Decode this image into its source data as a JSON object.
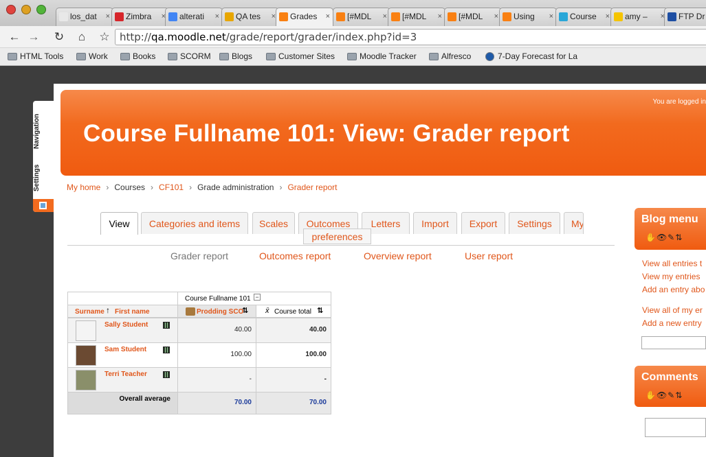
{
  "browser": {
    "tabs": [
      {
        "label": "los_dat",
        "color": "#e8e8e8"
      },
      {
        "label": "Zimbra",
        "color": "#d6262b"
      },
      {
        "label": "alterati",
        "color": "#4285f4"
      },
      {
        "label": "QA tes",
        "color": "#e8a600"
      },
      {
        "label": "Grades",
        "color": "#f98012"
      },
      {
        "label": "[#MDL",
        "color": "#f98012"
      },
      {
        "label": "[#MDL",
        "color": "#f98012"
      },
      {
        "label": "[#MDL",
        "color": "#f98012"
      },
      {
        "label": "Using",
        "color": "#f98012"
      },
      {
        "label": "Course",
        "color": "#2aa7d8"
      },
      {
        "label": "amy –",
        "color": "#f5c400"
      },
      {
        "label": "FTP Dr",
        "color": "#1e4fa3"
      }
    ],
    "address": {
      "prefix": "http://",
      "host": "qa.moodle.net",
      "path": "/grade/report/grader/index.php?id=3"
    },
    "bookmarks": [
      "HTML Tools",
      "Work",
      "Books",
      "SCORM",
      "Blogs",
      "Customer Sites",
      "Moodle Tracker",
      "Alfresco",
      "7-Day Forecast for La"
    ]
  },
  "dock": {
    "navigation": "Navigation",
    "settings": "Settings"
  },
  "header": {
    "logged_in": "You are logged in",
    "title": "Course Fullname 101: View: Grader report"
  },
  "breadcrumb": {
    "home": "My home",
    "courses": "Courses",
    "course": "CF101",
    "admin": "Grade administration",
    "current": "Grader report"
  },
  "tabs": [
    "View",
    "Categories and items",
    "Scales",
    "Outcomes",
    "Letters",
    "Import",
    "Export",
    "Settings",
    "My"
  ],
  "preferences": "preferences",
  "subtabs": [
    "Grader report",
    "Outcomes report",
    "Overview report",
    "User report"
  ],
  "grader": {
    "course_header": "Course Fullname 101",
    "surname": "Surname",
    "first_name": "First name",
    "item": "Prodding SCO",
    "course_total": "Course total",
    "students": [
      {
        "name": "Sally Student",
        "grade": "40.00",
        "total": "40.00"
      },
      {
        "name": "Sam Student",
        "grade": "100.00",
        "total": "100.00"
      },
      {
        "name": "Terri Teacher",
        "grade": "-",
        "total": "-"
      }
    ],
    "overall_label": "Overall average",
    "overall_grade": "70.00",
    "overall_total": "70.00"
  },
  "blocks": {
    "blog": {
      "title": "Blog menu",
      "links": [
        "View all entries t",
        "View my entries",
        "Add an entry abo",
        "View all of my er",
        "Add a new entry"
      ]
    },
    "comments": {
      "title": "Comments"
    },
    "icons": "✋👁✎⇅"
  },
  "colors": {
    "accent": "#f26a1e",
    "link": "#e0561a"
  }
}
